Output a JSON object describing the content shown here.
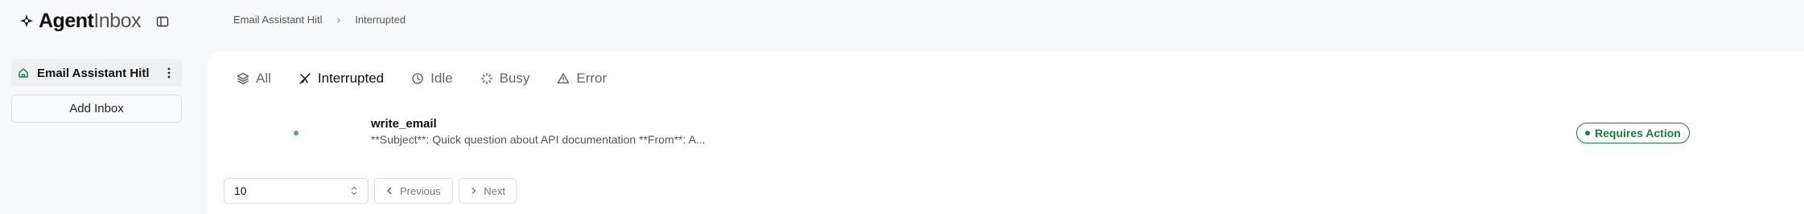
{
  "logo": {
    "part1": "Agent",
    "part2": "Inbox"
  },
  "breadcrumb": {
    "root": "Email Assistant Hitl",
    "current": "Interrupted"
  },
  "sidebar": {
    "inbox_label": "Email Assistant Hitl",
    "add_inbox_label": "Add Inbox"
  },
  "tabs": [
    {
      "label": "All",
      "icon": "layers-icon"
    },
    {
      "label": "Interrupted",
      "icon": "interrupted-icon"
    },
    {
      "label": "Idle",
      "icon": "clock-icon"
    },
    {
      "label": "Busy",
      "icon": "loader-icon"
    },
    {
      "label": "Error",
      "icon": "alert-triangle-icon"
    }
  ],
  "active_tab": "Interrupted",
  "threads": [
    {
      "title": "write_email",
      "description": "**Subject**: Quick question about API documentation **From**: A...",
      "status": "Requires Action"
    }
  ],
  "pagination": {
    "page_size": "10",
    "previous_label": "Previous",
    "next_label": "Next"
  },
  "colors": {
    "status_green": "#1e7d3a",
    "thread_dot": "#5b8fd6",
    "background": "#f7f8f9"
  }
}
